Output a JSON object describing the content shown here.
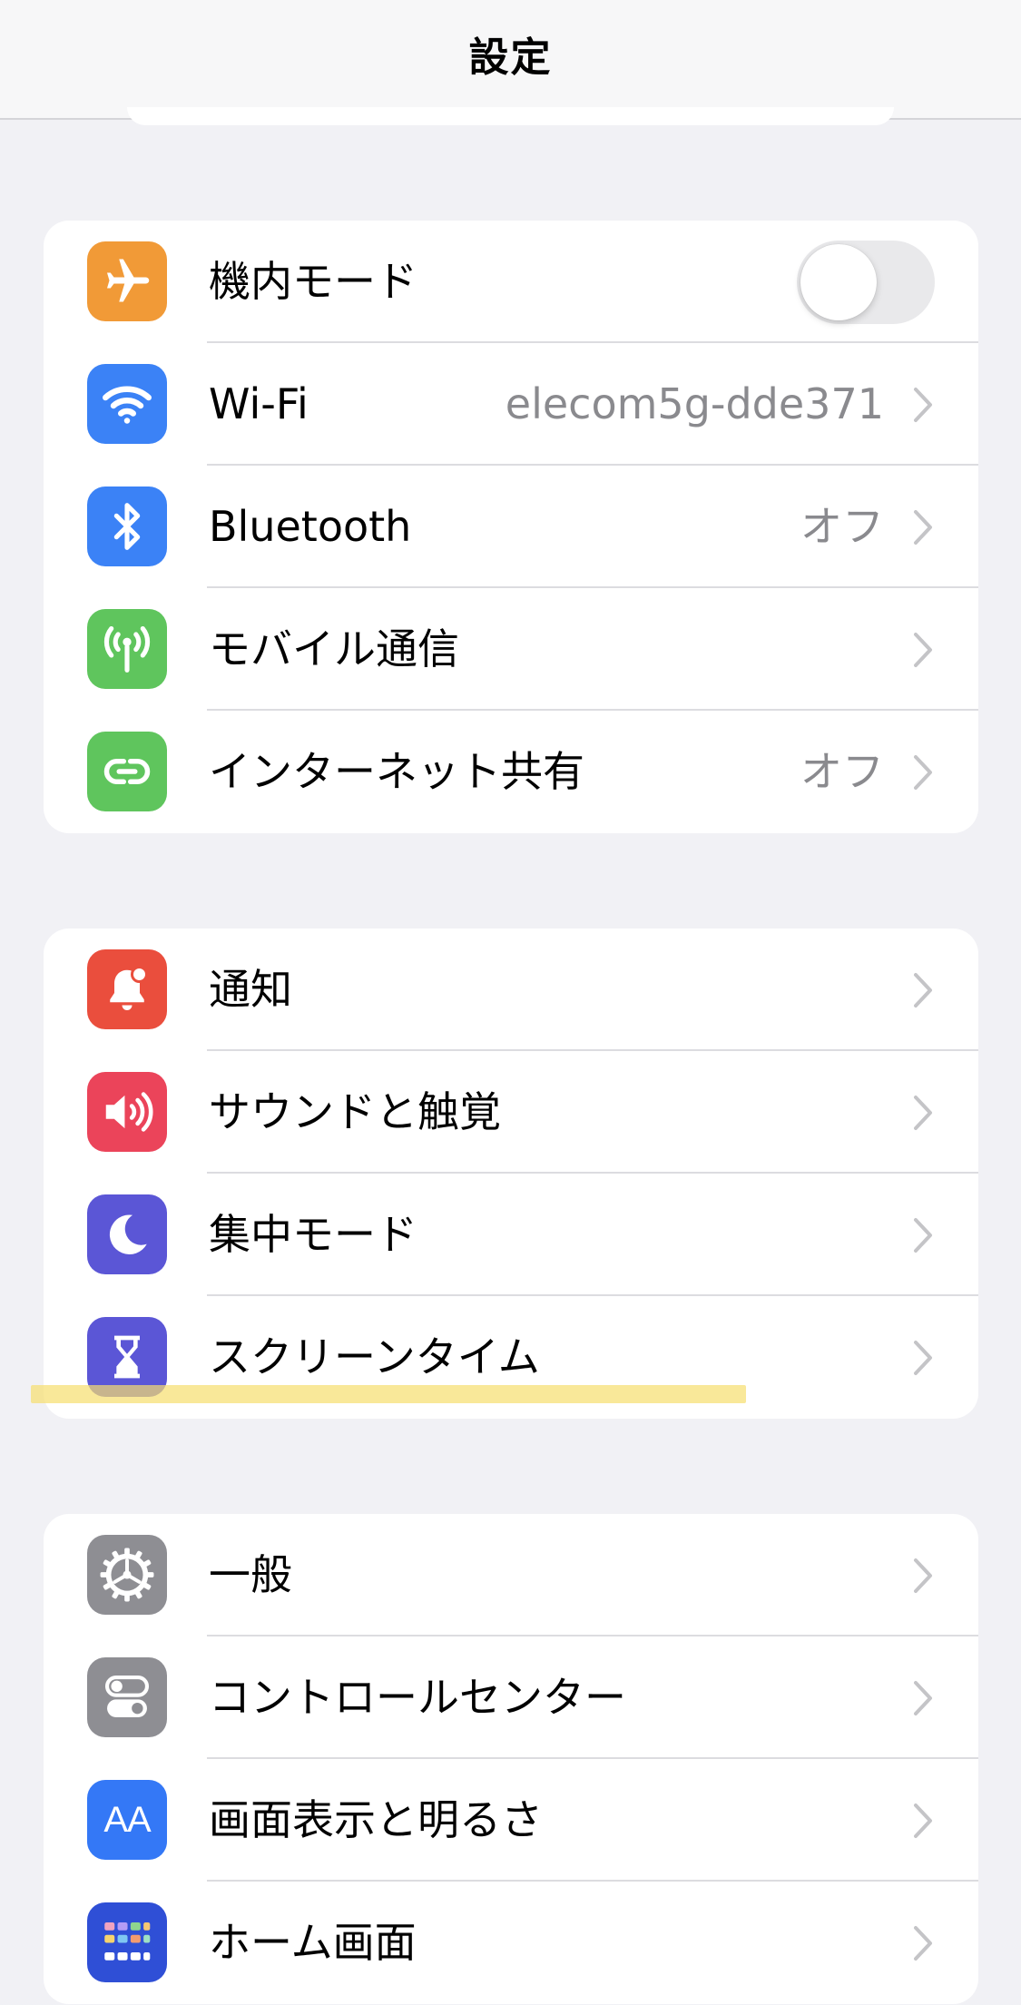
{
  "header": {
    "title": "設定"
  },
  "groups": [
    {
      "items": [
        {
          "label": "機内モード",
          "icon": "airplane-icon",
          "color": "#f19a37",
          "toggle": false
        },
        {
          "label": "Wi-Fi",
          "value": "elecom5g-dde371",
          "icon": "wifi-icon",
          "color": "#3b82f6"
        },
        {
          "label": "Bluetooth",
          "value": "オフ",
          "icon": "bluetooth-icon",
          "color": "#3b82f6"
        },
        {
          "label": "モバイル通信",
          "icon": "antenna-icon",
          "color": "#5fc55d"
        },
        {
          "label": "インターネット共有",
          "value": "オフ",
          "icon": "hotspot-icon",
          "color": "#5fc55d"
        }
      ]
    },
    {
      "items": [
        {
          "label": "通知",
          "icon": "bell-icon",
          "color": "#ea4e3d"
        },
        {
          "label": "サウンドと触覚",
          "icon": "speaker-icon",
          "color": "#eb445a"
        },
        {
          "label": "集中モード",
          "icon": "moon-icon",
          "color": "#5b56d6"
        },
        {
          "label": "スクリーンタイム",
          "icon": "hourglass-icon",
          "color": "#5b56d6"
        }
      ]
    },
    {
      "items": [
        {
          "label": "一般",
          "icon": "gear-icon",
          "color": "#8e8e93"
        },
        {
          "label": "コントロールセンター",
          "icon": "switches-icon",
          "color": "#8e8e93"
        },
        {
          "label": "画面表示と明るさ",
          "icon": "text-size-icon",
          "color": "#3478f6",
          "icon_text": "AA"
        },
        {
          "label": "ホーム画面",
          "icon": "home-screen-icon",
          "color": "#2f4fd6"
        }
      ]
    }
  ]
}
